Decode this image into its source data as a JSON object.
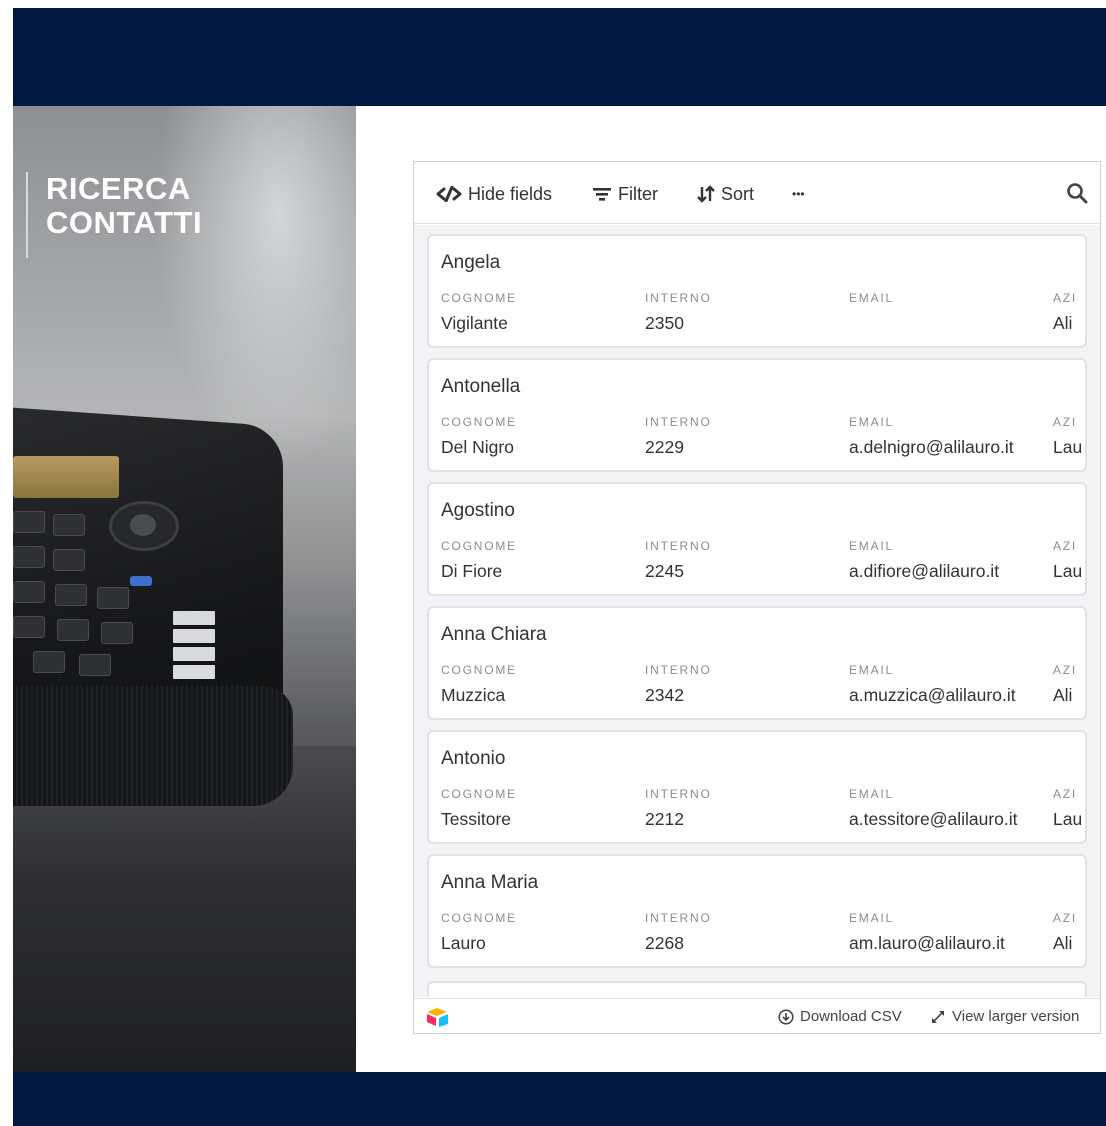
{
  "hero": {
    "title_line1": "RICERCA",
    "title_line2": "CONTATTI"
  },
  "toolbar": {
    "hide_fields_label": "Hide fields",
    "filter_label": "Filter",
    "sort_label": "Sort",
    "more_label": "•••"
  },
  "columns": {
    "cognome": "COGNOME",
    "interno": "INTERNO",
    "email": "EMAIL",
    "azienda": "AZI"
  },
  "contacts": [
    {
      "name": "Angela",
      "cognome": "Vigilante",
      "interno": "2350",
      "email": "",
      "azienda": "Ali"
    },
    {
      "name": "Antonella",
      "cognome": "Del Nigro",
      "interno": "2229",
      "email": "a.delnigro@alilauro.it",
      "azienda": "Lau"
    },
    {
      "name": "Agostino",
      "cognome": "Di Fiore",
      "interno": "2245",
      "email": "a.difiore@alilauro.it",
      "azienda": "Lau"
    },
    {
      "name": "Anna Chiara",
      "cognome": "Muzzica",
      "interno": "2342",
      "email": "a.muzzica@alilauro.it",
      "azienda": "Ali"
    },
    {
      "name": "Antonio",
      "cognome": "Tessitore",
      "interno": "2212",
      "email": "a.tessitore@alilauro.it",
      "azienda": "Lau"
    },
    {
      "name": "Anna Maria",
      "cognome": "Lauro",
      "interno": "2268",
      "email": "am.lauro@alilauro.it",
      "azienda": "Ali"
    }
  ],
  "footer": {
    "download_label": "Download CSV",
    "view_larger_label": "View larger version"
  },
  "colors": {
    "band": "#041941",
    "text": "#333333",
    "label": "#8a8d91"
  },
  "icons": {
    "hide_fields": "eye-slash-icon",
    "filter": "filter-icon",
    "sort": "sort-icon",
    "search": "search-icon",
    "download": "download-icon",
    "expand": "expand-icon",
    "logo": "airtable-logo-icon"
  }
}
